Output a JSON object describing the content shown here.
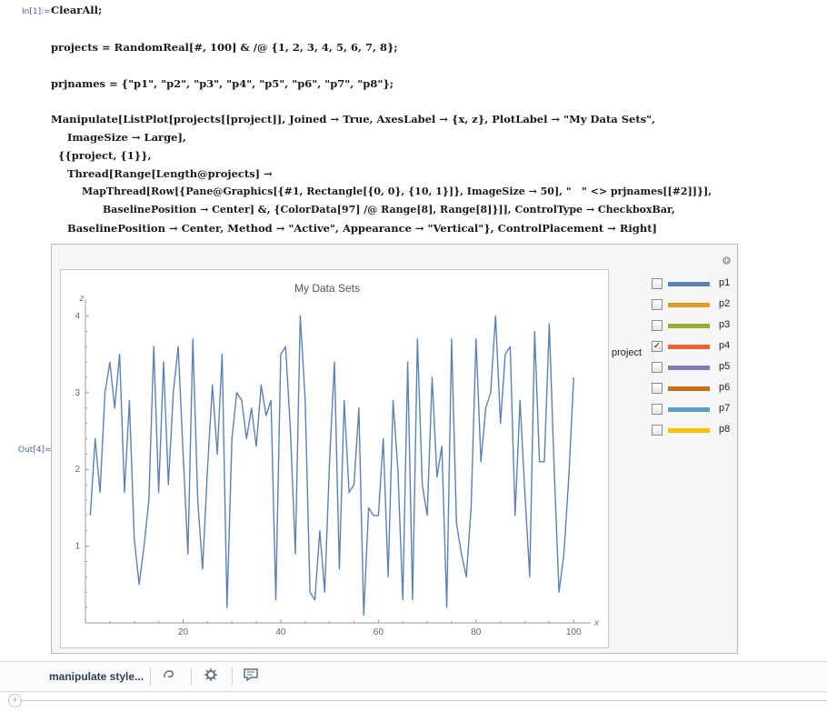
{
  "cells": {
    "in_label": "In[1]:=",
    "out_label": "Out[4]="
  },
  "code": {
    "line1": "ClearAll;",
    "line2": "projects = RandomReal[#, 100] & /@ {1, 2, 3, 4, 5, 6, 7, 8};",
    "line3": "prjnames = {\"p1\", \"p2\", \"p3\", \"p4\", \"p5\", \"p6\", \"p7\", \"p8\"};",
    "line4": "Manipulate[ListPlot[projects[[project]], Joined → True, AxesLabel → {x, z}, PlotLabel → \"My Data Sets\",",
    "line5": "ImageSize → Large],",
    "line6": "{{project, {1}},",
    "line7": "Thread[Range[Length@projects] →",
    "line8": "MapThread[Row[{Pane@Graphics[{#1, Rectangle[{0, 0}, {10, 1}]}, ImageSize → 50], \"   \" <> prjnames[[#2]]}],",
    "line9": "BaselinePosition → Center] &, {ColorData[97] /@ Range[8], Range[8]}]], ControlType → CheckboxBar,",
    "line10": "BaselinePosition → Center, Method → \"Active\", Appearance → \"Vertical\"}, ControlPlacement → Right]"
  },
  "chart_data": {
    "type": "line",
    "title": "My Data Sets",
    "xlabel": "x",
    "ylabel": "z",
    "xlim": [
      0,
      102
    ],
    "ylim": [
      0,
      4.1
    ],
    "xticks": [
      20,
      40,
      60,
      80,
      100
    ],
    "yticks": [
      1,
      2,
      3,
      4
    ],
    "grid": false,
    "series": [
      {
        "color": "#5e81b5",
        "x": [
          1,
          2,
          3,
          4,
          5,
          6,
          7,
          8,
          9,
          10,
          11,
          12,
          13,
          14,
          15,
          16,
          17,
          18,
          19,
          20,
          21,
          22,
          23,
          24,
          25,
          26,
          27,
          28,
          29,
          30,
          31,
          32,
          33,
          34,
          35,
          36,
          37,
          38,
          39,
          40,
          41,
          42,
          43,
          44,
          45,
          46,
          47,
          48,
          49,
          50,
          51,
          52,
          53,
          54,
          55,
          56,
          57,
          58,
          59,
          60,
          61,
          62,
          63,
          64,
          65,
          66,
          67,
          68,
          69,
          70,
          71,
          72,
          73,
          74,
          75,
          76,
          77,
          78,
          79,
          80,
          81,
          82,
          83,
          84,
          85,
          86,
          87,
          88,
          89,
          90,
          91,
          92,
          93,
          94,
          95,
          96,
          97,
          98,
          99,
          100
        ],
        "y": [
          1.4,
          2.4,
          1.7,
          3.0,
          3.4,
          2.8,
          3.5,
          1.7,
          2.9,
          1.1,
          0.5,
          1.0,
          1.6,
          3.6,
          1.7,
          3.4,
          1.8,
          3.0,
          3.6,
          2.2,
          0.9,
          3.7,
          1.6,
          0.7,
          2.0,
          3.1,
          2.2,
          3.5,
          0.2,
          2.4,
          3.0,
          2.9,
          2.4,
          2.8,
          2.3,
          3.1,
          2.7,
          2.9,
          0.3,
          3.5,
          3.6,
          2.5,
          0.9,
          4.0,
          2.9,
          0.4,
          0.3,
          1.2,
          0.4,
          2.1,
          3.4,
          0.7,
          2.9,
          1.7,
          1.8,
          2.8,
          0.1,
          1.5,
          1.4,
          1.4,
          2.4,
          0.6,
          2.9,
          2.0,
          0.3,
          3.4,
          0.3,
          3.7,
          1.8,
          1.4,
          3.2,
          1.9,
          2.3,
          0.2,
          3.7,
          1.3,
          0.9,
          0.6,
          1.5,
          3.7,
          2.1,
          2.8,
          3.0,
          4.0,
          2.6,
          3.5,
          3.6,
          1.4,
          2.9,
          1.7,
          0.6,
          3.8,
          2.1,
          2.1,
          3.9,
          2.0,
          0.4,
          0.9,
          1.9,
          3.2
        ]
      }
    ]
  },
  "control": {
    "label": "project",
    "options": [
      {
        "name": "p1",
        "color": "#5e81b5",
        "checked": false
      },
      {
        "name": "p2",
        "color": "#e19c24",
        "checked": false
      },
      {
        "name": "p3",
        "color": "#8fb032",
        "checked": false
      },
      {
        "name": "p4",
        "color": "#eb6235",
        "checked": true
      },
      {
        "name": "p5",
        "color": "#8778b3",
        "checked": false
      },
      {
        "name": "p6",
        "color": "#c56e1a",
        "checked": false
      },
      {
        "name": "p7",
        "color": "#5d9ec7",
        "checked": false
      },
      {
        "name": "p8",
        "color": "#ffbf00",
        "checked": false
      }
    ],
    "check_glyph": "✓"
  },
  "toolbar": {
    "style_label": "manipulate style...",
    "plus": "+"
  }
}
